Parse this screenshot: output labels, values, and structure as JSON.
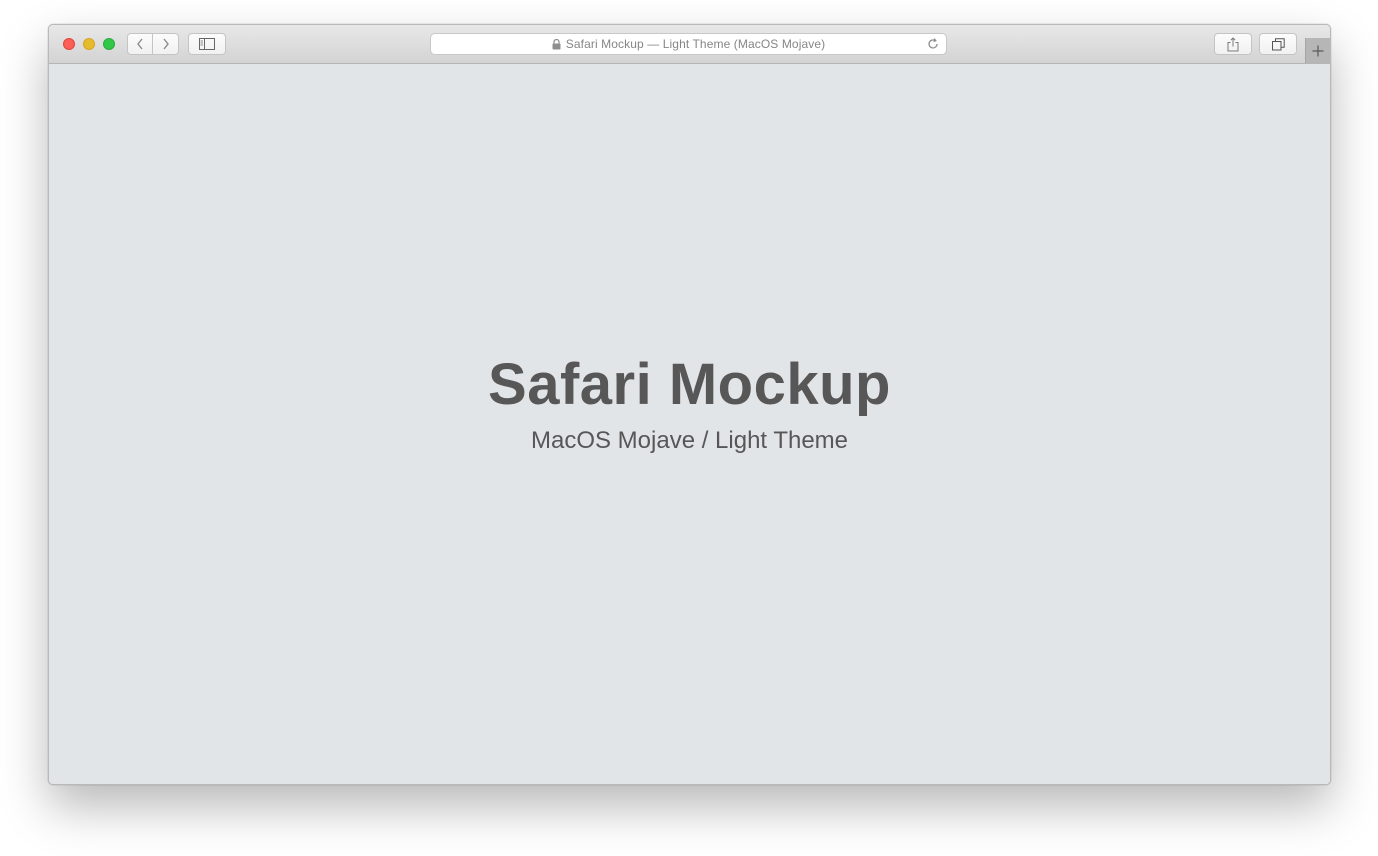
{
  "window": {
    "address_text": "Safari Mockup — Light Theme (MacOS Mojave)",
    "icons": {
      "close": "close-light",
      "minimize": "minimize-light",
      "zoom": "zoom-light",
      "back": "chevron-left-icon",
      "forward": "chevron-right-icon",
      "sidebar": "sidebar-icon",
      "lock": "lock-icon",
      "reload": "reload-icon",
      "share": "share-icon",
      "tabs": "tabs-overview-icon",
      "new_tab": "plus-icon"
    },
    "colors": {
      "close": "#fc5f57",
      "minimize": "#e6bb2e",
      "zoom": "#33c748",
      "content_background": "#e2e5e8",
      "text": "#575757"
    }
  },
  "page": {
    "title": "Safari Mockup",
    "subtitle": "MacOS Mojave / Light Theme"
  }
}
